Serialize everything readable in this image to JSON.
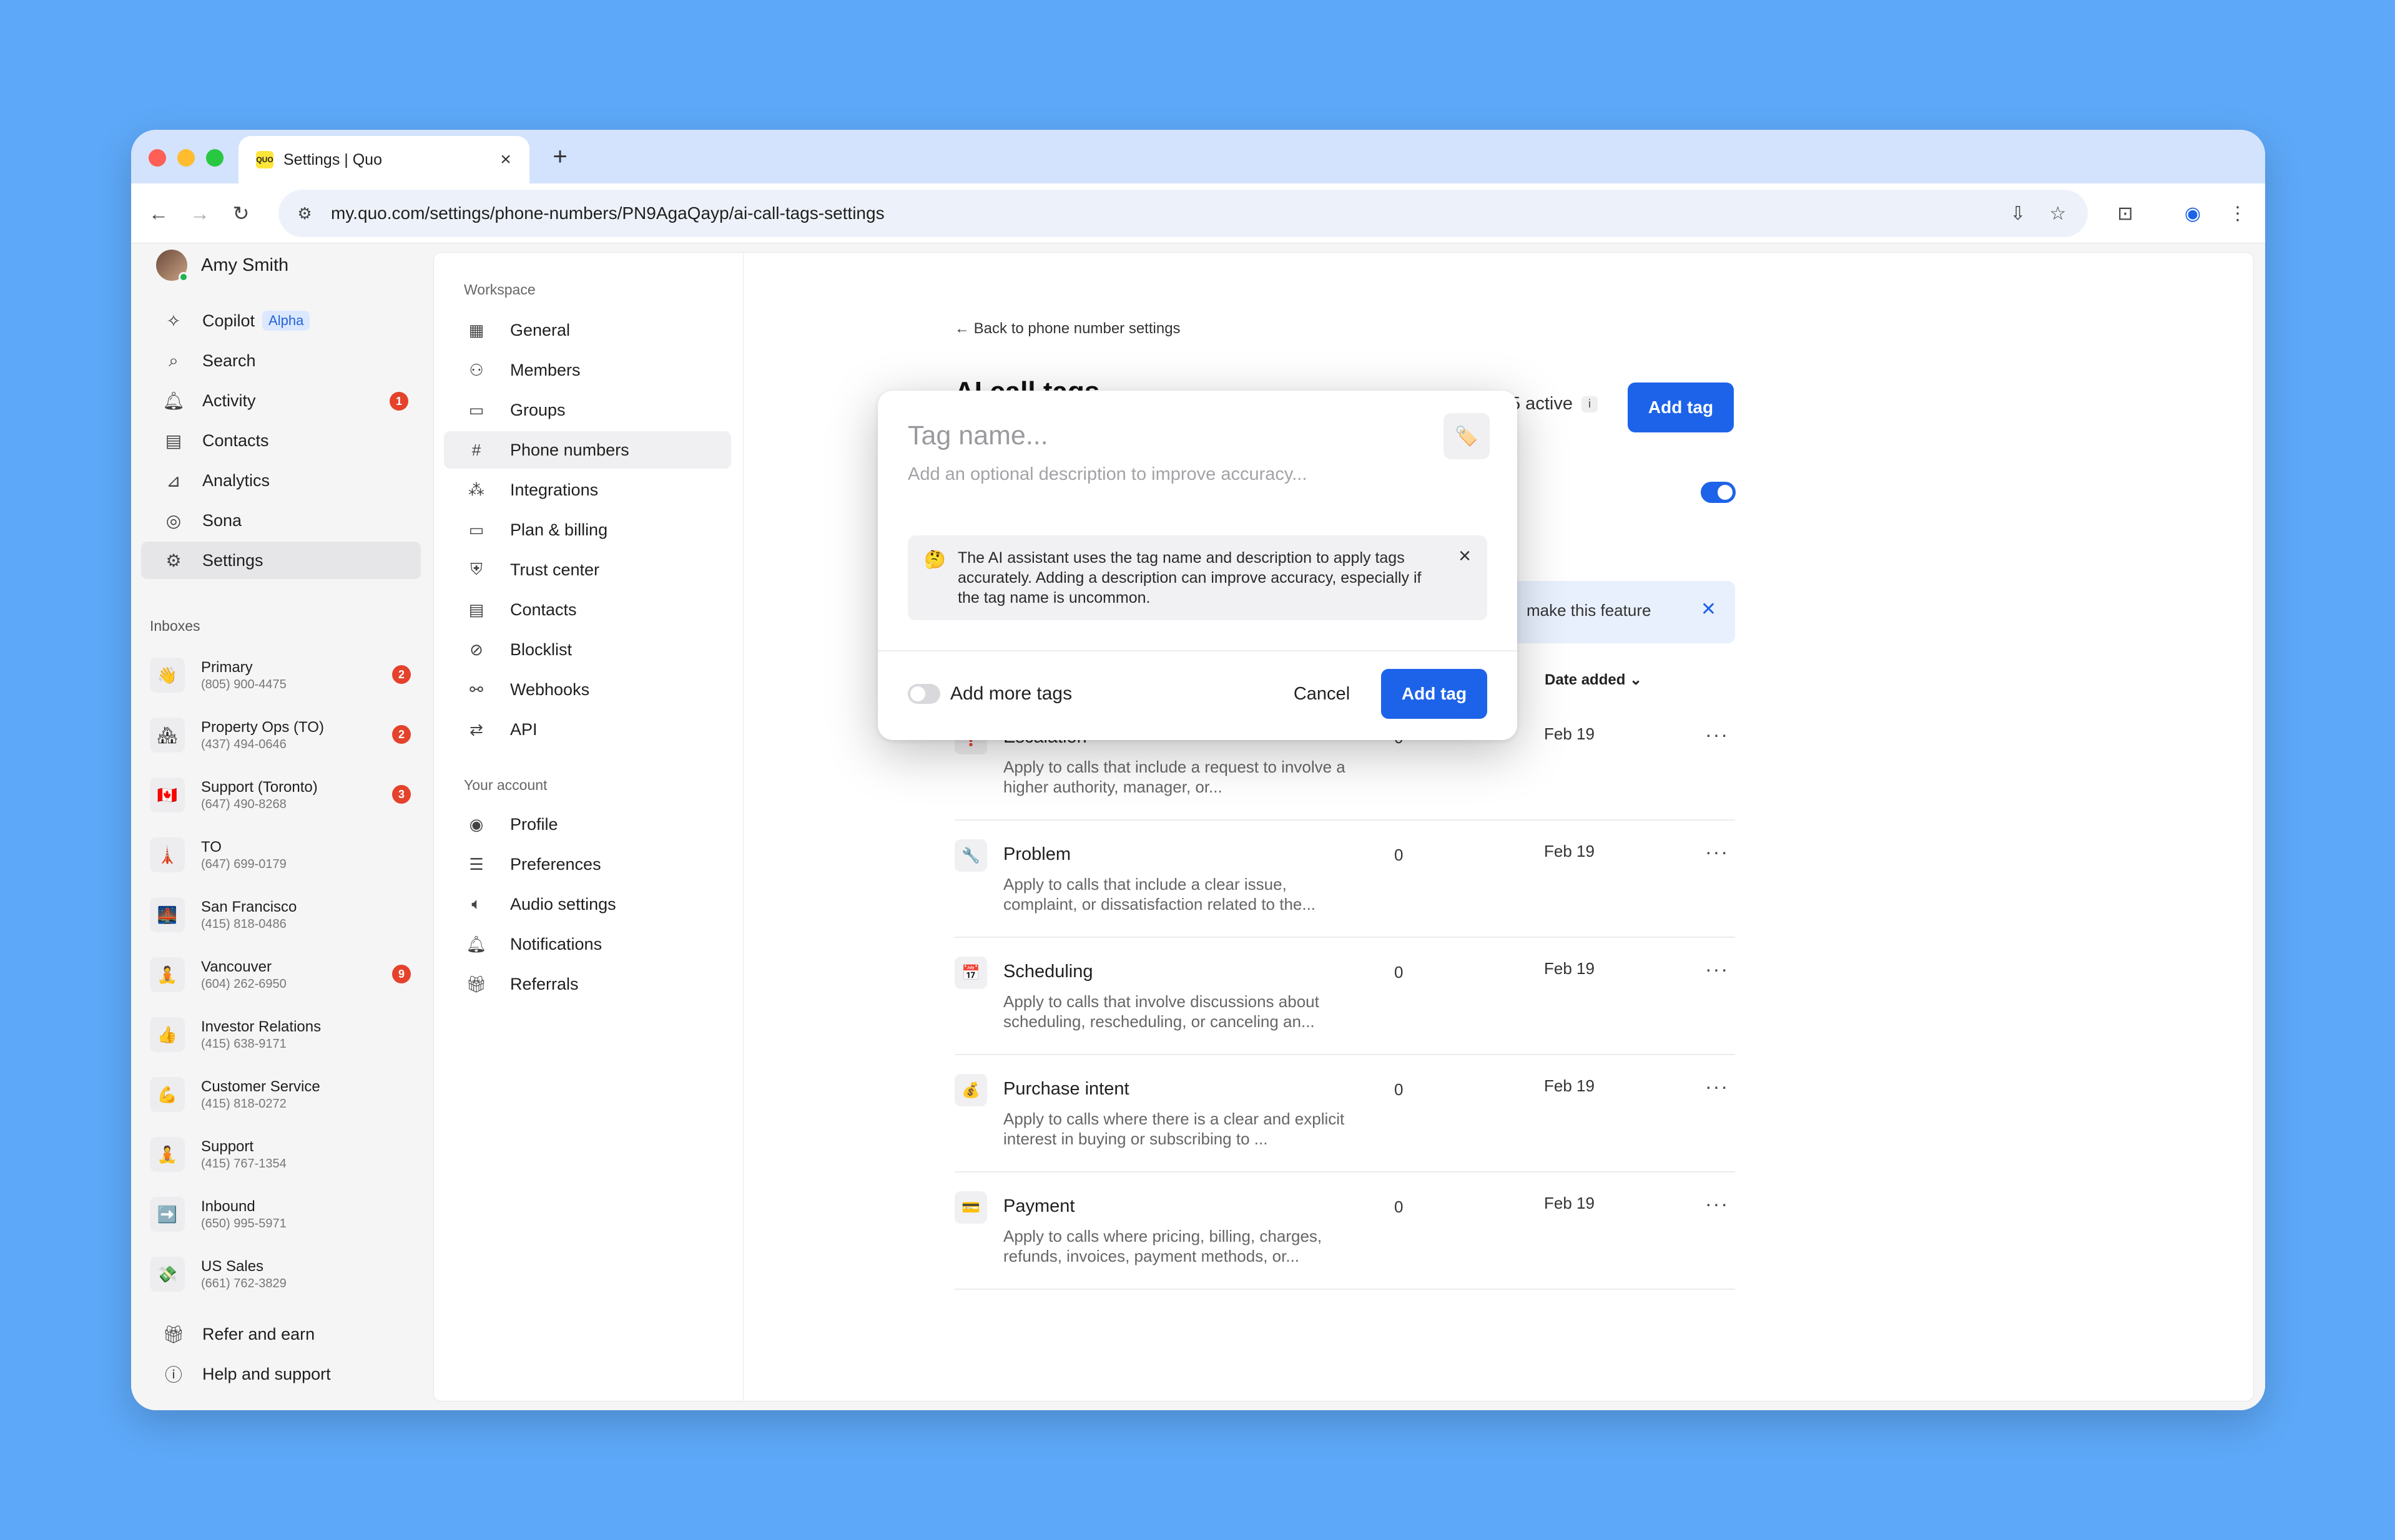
{
  "browser": {
    "tab_title": "Settings | Quo",
    "favicon_text": "QUO",
    "url": "my.quo.com/settings/phone-numbers/PN9AgaQayp/ai-call-tags-settings"
  },
  "sidebar": {
    "user_name": "Amy Smith",
    "nav": [
      {
        "label": "Copilot",
        "tag": "Alpha",
        "icon": "sparkle-icon"
      },
      {
        "label": "Search",
        "icon": "search-icon"
      },
      {
        "label": "Activity",
        "badge": "1",
        "icon": "bell-icon"
      },
      {
        "label": "Contacts",
        "icon": "contacts-icon"
      },
      {
        "label": "Analytics",
        "icon": "analytics-icon"
      },
      {
        "label": "Sona",
        "icon": "sona-icon"
      },
      {
        "label": "Settings",
        "icon": "gear-icon"
      }
    ],
    "inboxes_heading": "Inboxes",
    "inboxes": [
      {
        "emoji": "👋",
        "name": "Primary",
        "phone": "(805) 900-4475",
        "badge": "2"
      },
      {
        "emoji": "🏘",
        "name": "Property Ops (TO)",
        "phone": "(437) 494-0646",
        "badge": "2"
      },
      {
        "emoji": "🇨🇦",
        "name": "Support (Toronto)",
        "phone": "(647) 490-8268",
        "badge": "3"
      },
      {
        "emoji": "🗼",
        "name": "TO",
        "phone": "(647) 699-0179",
        "badge": ""
      },
      {
        "emoji": "🌉",
        "name": "San Francisco",
        "phone": "(415) 818-0486",
        "badge": ""
      },
      {
        "emoji": "🧘",
        "name": "Vancouver",
        "phone": "(604) 262-6950",
        "badge": "9"
      },
      {
        "emoji": "👍",
        "name": "Investor Relations",
        "phone": "(415) 638-9171",
        "badge": ""
      },
      {
        "emoji": "💪",
        "name": "Customer Service",
        "phone": "(415) 818-0272",
        "badge": ""
      },
      {
        "emoji": "🧘",
        "name": "Support",
        "phone": "(415) 767-1354",
        "badge": ""
      },
      {
        "emoji": "➡️",
        "name": "Inbound",
        "phone": "(650) 995-5971",
        "badge": ""
      },
      {
        "emoji": "💸",
        "name": "US Sales",
        "phone": "(661) 762-3829",
        "badge": ""
      }
    ],
    "refer": "Refer and earn",
    "help": "Help and support"
  },
  "settings_nav": {
    "workspace_heading": "Workspace",
    "workspace": [
      {
        "label": "General",
        "icon": "building-icon"
      },
      {
        "label": "Members",
        "icon": "members-icon"
      },
      {
        "label": "Groups",
        "icon": "folder-icon"
      },
      {
        "label": "Phone numbers",
        "icon": "hash-icon"
      },
      {
        "label": "Integrations",
        "icon": "integrations-icon"
      },
      {
        "label": "Plan & billing",
        "icon": "card-icon"
      },
      {
        "label": "Trust center",
        "icon": "shield-icon"
      },
      {
        "label": "Contacts",
        "icon": "contacts-icon"
      },
      {
        "label": "Blocklist",
        "icon": "block-icon"
      },
      {
        "label": "Webhooks",
        "icon": "webhooks-icon"
      },
      {
        "label": "API",
        "icon": "api-icon"
      }
    ],
    "account_heading": "Your account",
    "account": [
      {
        "label": "Profile",
        "icon": "profile-icon"
      },
      {
        "label": "Preferences",
        "icon": "sliders-icon"
      },
      {
        "label": "Audio settings",
        "icon": "speaker-icon"
      },
      {
        "label": "Notifications",
        "icon": "bell-icon"
      },
      {
        "label": "Referrals",
        "icon": "gift-icon"
      }
    ]
  },
  "main": {
    "back_link": "← Back to phone number settings",
    "title": "AI call tags",
    "active_count": "5 active",
    "add_tag": "Add tag",
    "banner_text": "make this feature",
    "date_header": "Date added ⌄",
    "tags": [
      {
        "emoji": "❗",
        "name": "Escalation",
        "desc": "Apply to calls that include a request to involve a higher authority, manager, or...",
        "count": "0",
        "date": "Feb 19"
      },
      {
        "emoji": "🔧",
        "name": "Problem",
        "desc": "Apply to calls that include a clear issue, complaint, or dissatisfaction related to the...",
        "count": "0",
        "date": "Feb 19"
      },
      {
        "emoji": "📅",
        "name": "Scheduling",
        "desc": "Apply to calls that involve discussions about scheduling, rescheduling, or canceling an...",
        "count": "0",
        "date": "Feb 19"
      },
      {
        "emoji": "💰",
        "name": "Purchase intent",
        "desc": "Apply to calls where there is a clear and explicit interest in buying or subscribing to ...",
        "count": "0",
        "date": "Feb 19"
      },
      {
        "emoji": "💳",
        "name": "Payment",
        "desc": "Apply to calls where pricing, billing, charges, refunds, invoices, payment methods, or...",
        "count": "0",
        "date": "Feb 19"
      }
    ]
  },
  "modal": {
    "name_placeholder": "Tag name...",
    "desc_placeholder": "Add an optional description to improve accuracy...",
    "emoji": "🏷️",
    "hint_emoji": "🤔",
    "hint": "The AI assistant uses the tag name and description to apply tags accurately. Adding a description can improve accuracy, especially if the tag name is uncommon.",
    "add_more": "Add more tags",
    "cancel": "Cancel",
    "submit": "Add tag"
  },
  "colors": {
    "accent": "#1D63E9",
    "badge": "#E5422B",
    "background": "#5DA8F8"
  }
}
